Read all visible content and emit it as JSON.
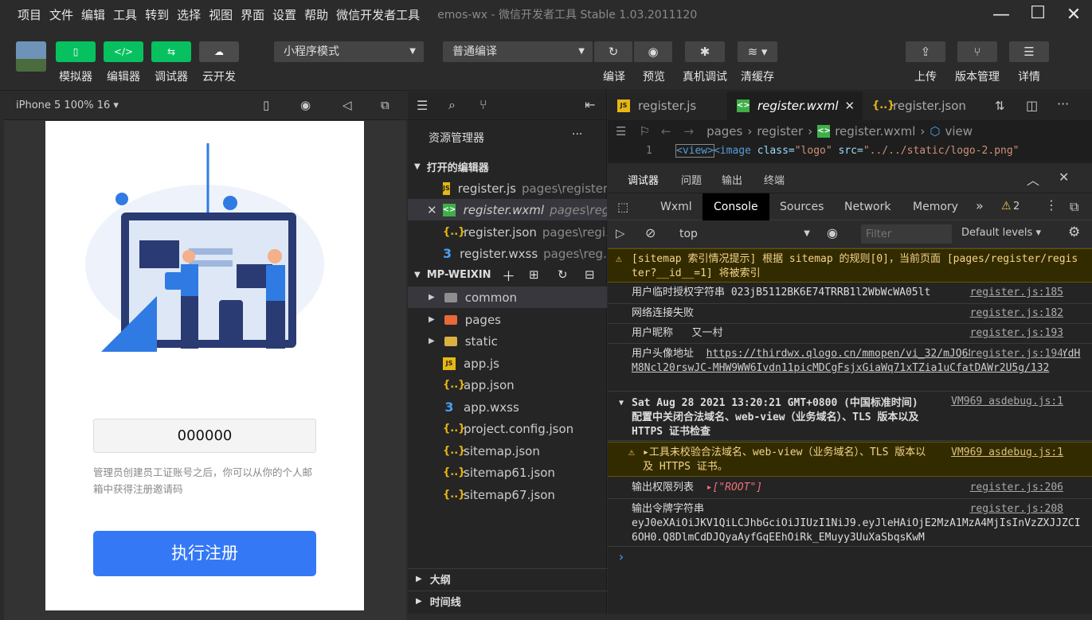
{
  "menu": {
    "items": [
      "项目",
      "文件",
      "编辑",
      "工具",
      "转到",
      "选择",
      "视图",
      "界面",
      "设置",
      "帮助",
      "微信开发者工具"
    ],
    "window_title": "emos-wx - 微信开发者工具 Stable 1.03.2011120"
  },
  "toolbar": {
    "simulator": "模拟器",
    "editor": "编辑器",
    "debugger": "调试器",
    "cloud": "云开发",
    "mode_select": "小程序模式",
    "compile_select": "普通编译",
    "compile": "编译",
    "preview": "预览",
    "device_debug": "真机调试",
    "clear_cache": "清缓存",
    "upload": "上传",
    "version": "版本管理",
    "details": "详情"
  },
  "simulator": {
    "device": "iPhone 5 100% 16 ▾",
    "code_value": "000000",
    "hint": "管理员创建员工证账号之后，你可以从你的个人邮箱中获得注册邀请码",
    "register_button": "执行注册"
  },
  "explorer": {
    "title": "资源管理器",
    "more": "···",
    "open_editors": "打开的编辑器",
    "open_files": [
      {
        "name": "register.js",
        "path": "pages\\register",
        "icon": "js"
      },
      {
        "name": "register.wxml",
        "path": "pages\\reg...",
        "icon": "wxml"
      },
      {
        "name": "register.json",
        "path": "pages\\regi...",
        "icon": "json"
      },
      {
        "name": "register.wxss",
        "path": "pages\\reg...",
        "icon": "wxss"
      }
    ],
    "project": "MP-WEIXIN",
    "tree": [
      {
        "name": "common",
        "icon": "folder"
      },
      {
        "name": "pages",
        "icon": "pages"
      },
      {
        "name": "static",
        "icon": "static"
      },
      {
        "name": "app.js",
        "icon": "js"
      },
      {
        "name": "app.json",
        "icon": "json"
      },
      {
        "name": "app.wxss",
        "icon": "wxss"
      },
      {
        "name": "project.config.json",
        "icon": "json"
      },
      {
        "name": "sitemap.json",
        "icon": "json"
      },
      {
        "name": "sitemap61.json",
        "icon": "json"
      },
      {
        "name": "sitemap67.json",
        "icon": "json"
      }
    ],
    "outline": "大纲",
    "timeline": "时间线"
  },
  "editor": {
    "tabs": [
      "register.js",
      "register.wxml",
      "register.json"
    ],
    "breadcrumb": [
      "pages",
      "register",
      "register.wxml",
      "view"
    ],
    "line_number": "1",
    "code": {
      "view_open": "<view>",
      "image_tag": "<image",
      "class_attr": "class=",
      "class_val": "\"logo\"",
      "src_attr": "src=",
      "src_val": "\"../../static/logo-2.png\""
    }
  },
  "devtools": {
    "tabs1": [
      "调试器",
      "问题",
      "输出",
      "终端"
    ],
    "tabs2": [
      "Wxml",
      "Console",
      "Sources",
      "Network",
      "Memory"
    ],
    "more_tabs": "»",
    "warning_count": "2",
    "context": "top",
    "filter_placeholder": "Filter",
    "levels": "Default levels ▾",
    "logs": [
      {
        "type": "warn",
        "text": "[sitemap 索引情况提示] 根据 sitemap 的规则[0]，当前页面 [pages/register/register?__id__=1] 将被索引",
        "src": ""
      },
      {
        "type": "log",
        "text": "用户临时授权字符串 023jB5112BK6E74TRRB1l2WbWcWA05lt",
        "src": "register.js:185"
      },
      {
        "type": "log",
        "text": "网络连接失败",
        "src": "register.js:182"
      },
      {
        "type": "log",
        "text": "用户昵称   又一村",
        "src": "register.js:193"
      },
      {
        "type": "log",
        "label": "用户头像地址",
        "link": "https://thirdwx.qlogo.cn/mmopen/vi_32/mJQ68h2NfxVIrC2iCPPYdHM8Ncl20rswJC-MHW9WW6Ivdn11picMDCgFsjxGiaWq71xTZia1uCfatDAWr2U5g/132",
        "src": "register.js:194"
      },
      {
        "type": "group",
        "text": "Sat Aug 28 2021 13:20:21 GMT+0800 (中国标准时间) 配置中关闭合法域名、web-view（业务域名）、TLS 版本以及 HTTPS 证书检查",
        "src": "VM969 asdebug.js:1"
      },
      {
        "type": "warn",
        "text": "▸工具未校验合法域名、web-view（业务域名）、TLS 版本以及 HTTPS 证书。",
        "src": "VM969 asdebug.js:1"
      },
      {
        "type": "log",
        "label": "输出权限列表",
        "value": "▸[\"ROOT\"]",
        "src": "register.js:206"
      },
      {
        "type": "log",
        "label": "输出令牌字符串",
        "value": "eyJ0eXAiOiJKV1QiLCJhbGciOiJIUzI1NiJ9.eyJleHAiOjE2MzA1MzA4MjIsInVzZXJJZCI6OH0.Q8DlmCdDJQyaAyfGqEEhOiRk_EMuyy3UuXaSbqsKwM",
        "src": "register.js:208"
      }
    ],
    "prompt": "›"
  },
  "colors": {
    "accent_green": "#07c160",
    "primary_blue": "#3478f6",
    "warn_bg": "#332b00"
  }
}
